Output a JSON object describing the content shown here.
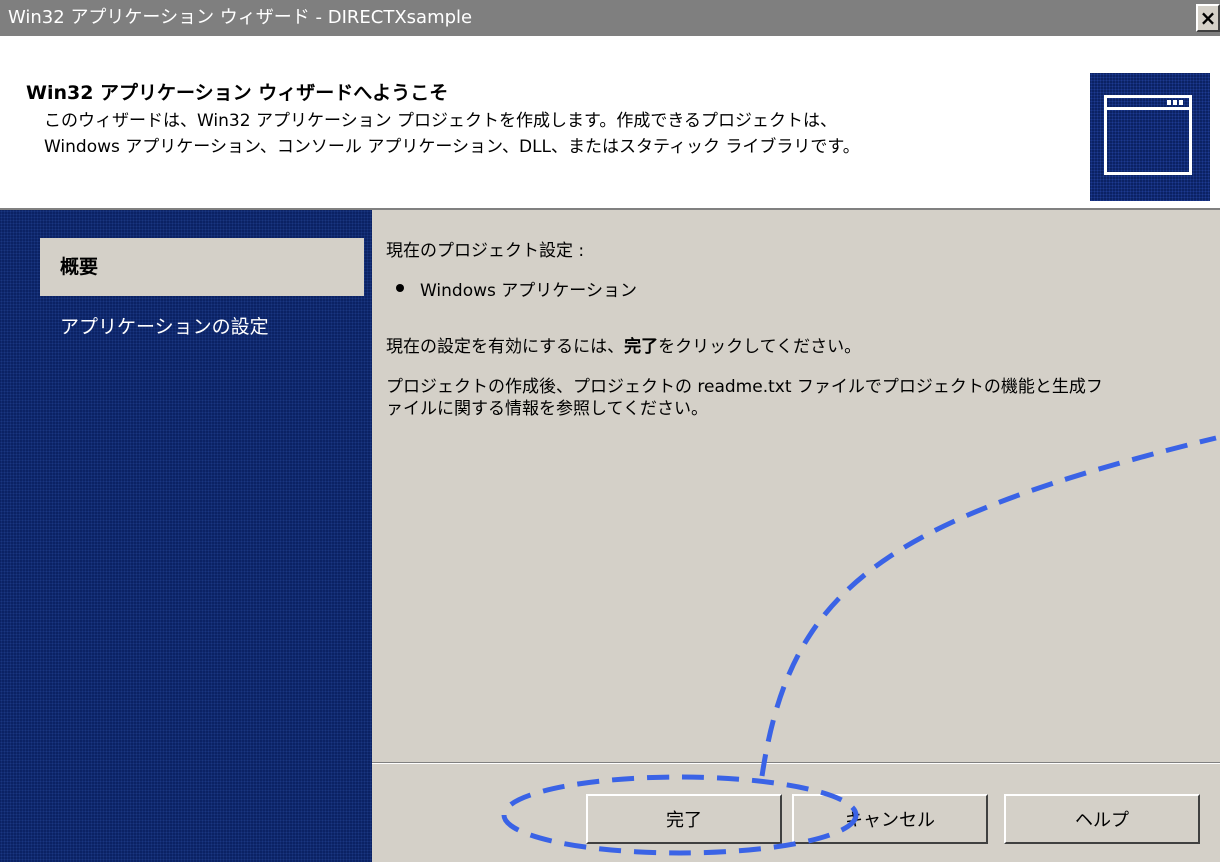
{
  "window": {
    "title": "Win32 アプリケーション ウィザード - DIRECTXsample",
    "close_glyph": "×"
  },
  "header": {
    "title": "Win32 アプリケーション ウィザードへようこそ",
    "description_lines": [
      "このウィザードは、Win32 アプリケーション プロジェクトを作成します。作成できるプロジェクトは、",
      "Windows アプリケーション、コンソール アプリケーション、DLL、またはスタティック ライブラリです。"
    ],
    "icon": "application-window-icon"
  },
  "sidebar": {
    "items": [
      {
        "label": "概要",
        "active": true
      },
      {
        "label": "アプリケーションの設定",
        "active": false
      }
    ]
  },
  "content": {
    "settings_heading": "現在のプロジェクト設定 :",
    "settings_items": [
      "Windows アプリケーション"
    ],
    "instruction_prefix": "現在の設定を有効にするには、",
    "instruction_bold": "完了",
    "instruction_suffix": "をクリックしてください。",
    "info_lines": [
      "プロジェクトの作成後、プロジェクトの readme.txt ファイルでプロジェクトの機能と生成フ",
      "ァイルに関する情報を参照してください。"
    ]
  },
  "buttons": {
    "finish": "完了",
    "cancel": "キャンセル",
    "help": "ヘルプ"
  },
  "annotation": {
    "color": "#3a63e6",
    "style": "dashed ellipse around finish button with curved dashed line"
  }
}
